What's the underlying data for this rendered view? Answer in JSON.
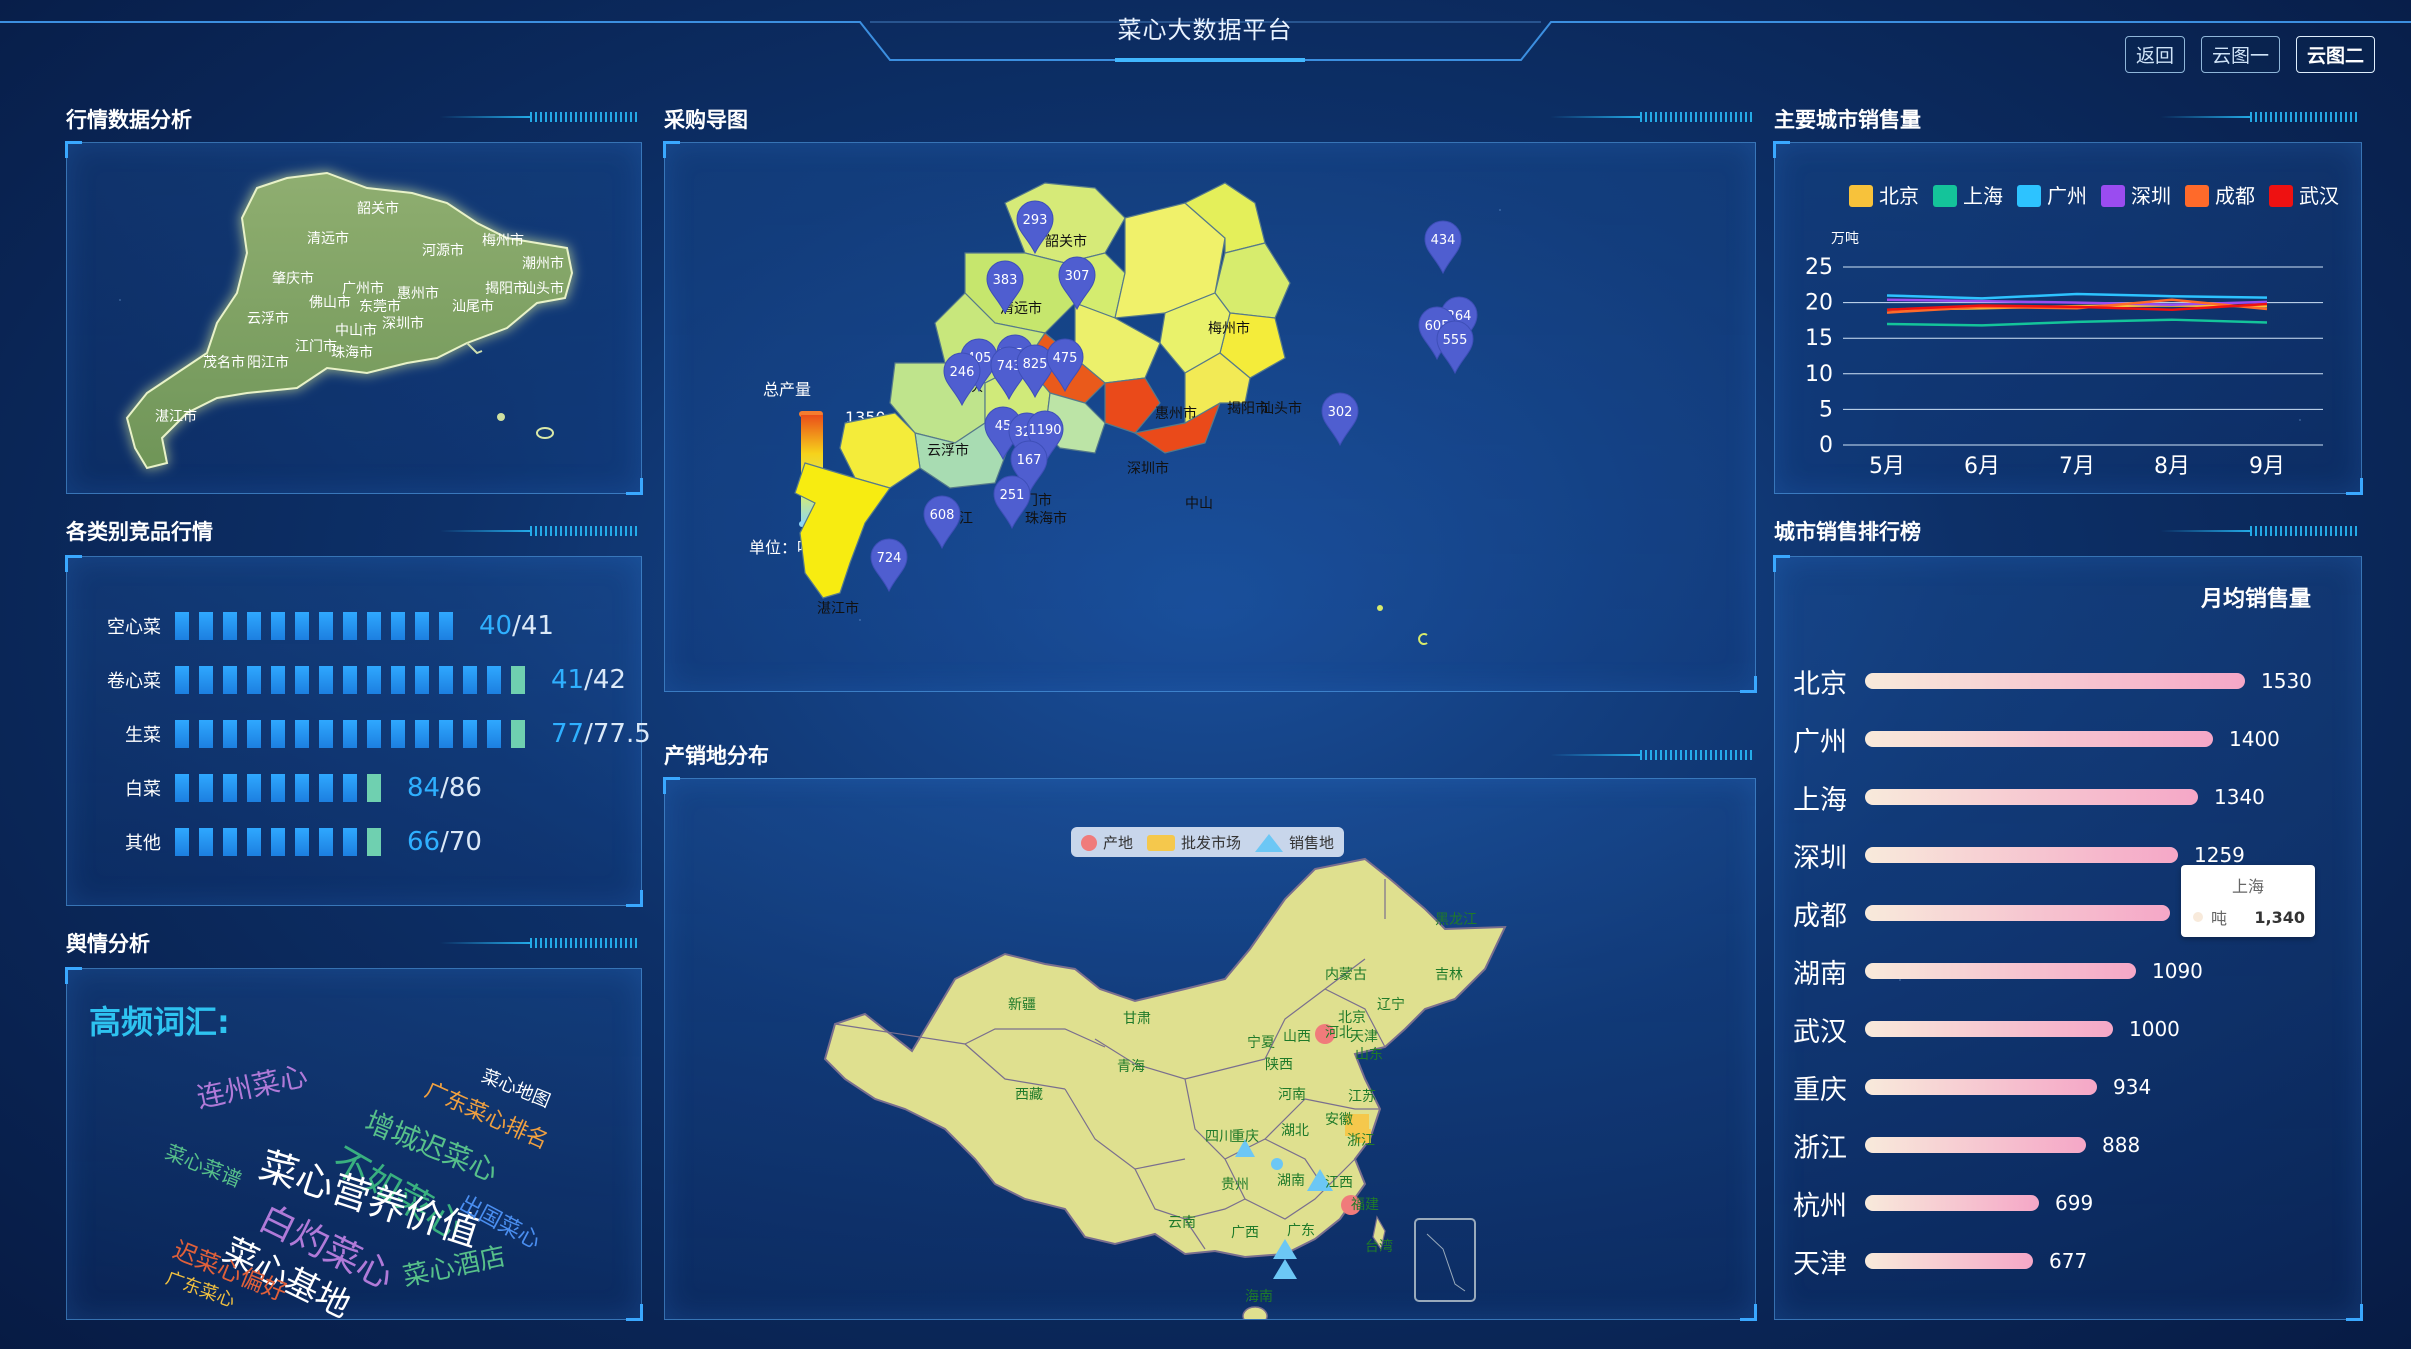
{
  "header": {
    "title": "菜心大数据平台",
    "buttons": [
      {
        "label": "返回",
        "active": false
      },
      {
        "label": "云图一",
        "active": false
      },
      {
        "label": "云图二",
        "active": true
      }
    ]
  },
  "market_analysis": {
    "title": "行情数据分析",
    "cities": [
      "韶关市",
      "清远市",
      "河源市",
      "梅州市",
      "潮州市",
      "肇庆市",
      "广州市",
      "惠州市",
      "揭阳市",
      "汕头市",
      "佛山市",
      "东莞市",
      "汕尾市",
      "云浮市",
      "中山市",
      "深圳市",
      "江门市",
      "珠海市",
      "茂名市",
      "阳江市",
      "湛江市"
    ]
  },
  "competitor": {
    "title": "各类别竞品行情",
    "rows": [
      {
        "label": "空心菜",
        "a": "40",
        "b": "/41"
      },
      {
        "label": "卷心菜",
        "a": "41",
        "b": "/42"
      },
      {
        "label": "生菜",
        "a": "77",
        "b": "/77.5"
      },
      {
        "label": "白菜",
        "a": "84",
        "b": "/86"
      },
      {
        "label": "其他",
        "a": "66",
        "b": "/70"
      }
    ]
  },
  "sentiment": {
    "title": "舆情分析",
    "cloud_title": "高频词汇:",
    "words": [
      "连州菜心",
      "增城迟菜心",
      "广东菜心排名",
      "菜心地图",
      "不如菜心",
      "菜心菜谱",
      "菜心营养价值",
      "出国菜心",
      "白灼菜心",
      "菜心基地",
      "迟菜心偏好",
      "菜心酒店",
      "广东菜心"
    ]
  },
  "purchase_map": {
    "title": "采购导图",
    "legend_title": "总产量",
    "legend_max": "1350",
    "legend_min": "0",
    "legend_unit": "单位：吨",
    "south_label": "s",
    "city_labels": [
      "韶关市",
      "清远市",
      "梅州市",
      "云浮市",
      "江门市",
      "湛江市",
      "揭阳市",
      "汕头市",
      "惠州市",
      "阳江",
      "珠海市",
      "深圳市",
      "肇庆",
      "中山"
    ],
    "pins": [
      {
        "value": "293"
      },
      {
        "value": "434"
      },
      {
        "value": "383"
      },
      {
        "value": "307"
      },
      {
        "value": "264"
      },
      {
        "value": "605"
      },
      {
        "value": "555"
      },
      {
        "value": "405"
      },
      {
        "value": "1350"
      },
      {
        "value": "743"
      },
      {
        "value": "825"
      },
      {
        "value": "475"
      },
      {
        "value": "246"
      },
      {
        "value": "302"
      },
      {
        "value": "45"
      },
      {
        "value": "320"
      },
      {
        "value": "1190"
      },
      {
        "value": "167"
      },
      {
        "value": "251"
      },
      {
        "value": "608"
      },
      {
        "value": "724"
      }
    ]
  },
  "distribution_map": {
    "title": "产销地分布",
    "legend": [
      {
        "label": "产地",
        "color": "#f07b7b"
      },
      {
        "label": "批发市场",
        "color": "#f5c84c"
      },
      {
        "label": "销售地",
        "color": "#6cc7f5"
      }
    ],
    "provinces": [
      "黑龙江",
      "吉林",
      "辽宁",
      "内蒙古",
      "北京",
      "天津",
      "河北",
      "山西",
      "山东",
      "宁夏",
      "陕西",
      "河南",
      "江苏",
      "甘肃",
      "青海",
      "新疆",
      "西藏",
      "四川",
      "重庆",
      "湖北",
      "安徽",
      "浙江",
      "江西",
      "湖南",
      "福建",
      "贵州",
      "云南",
      "广西",
      "广东",
      "台湾",
      "海南"
    ]
  },
  "city_sales": {
    "title": "主要城市销售量",
    "chart_data": {
      "type": "line",
      "x": [
        "5月",
        "6月",
        "7月",
        "8月",
        "9月"
      ],
      "ylabel": "万吨",
      "ylim": [
        0,
        25
      ],
      "yticks": [
        "0",
        "5",
        "10",
        "15",
        "20",
        "25"
      ],
      "series": [
        {
          "name": "北京",
          "color": "#f7c23b",
          "values": [
            19.0,
            19.2,
            19.5,
            19.6,
            19.5
          ]
        },
        {
          "name": "上海",
          "color": "#14c49a",
          "values": [
            17.0,
            16.8,
            17.3,
            17.6,
            17.2
          ]
        },
        {
          "name": "广州",
          "color": "#2dc3ff",
          "values": [
            21.0,
            20.6,
            21.2,
            20.9,
            20.7
          ]
        },
        {
          "name": "深圳",
          "color": "#9a4cf0",
          "values": [
            20.4,
            20.2,
            20.0,
            19.7,
            20.1
          ]
        },
        {
          "name": "成都",
          "color": "#ff6a2a",
          "values": [
            18.6,
            19.4,
            19.2,
            20.4,
            19.1
          ]
        },
        {
          "name": "武汉",
          "color": "#ee1111",
          "values": [
            19.0,
            19.6,
            19.4,
            19.0,
            19.8
          ]
        }
      ]
    }
  },
  "ranking": {
    "title": "城市销售排行榜",
    "subtitle": "月均销售量",
    "rows": [
      {
        "name": "北京",
        "value": 1530
      },
      {
        "name": "广州",
        "value": 1400
      },
      {
        "name": "上海",
        "value": 1340
      },
      {
        "name": "深圳",
        "value": 1259
      },
      {
        "name": "成都",
        "value": 1229
      },
      {
        "name": "湖南",
        "value": 1090
      },
      {
        "name": "武汉",
        "value": 1000
      },
      {
        "name": "重庆",
        "value": 934
      },
      {
        "name": "浙江",
        "value": 888
      },
      {
        "name": "杭州",
        "value": 699
      },
      {
        "name": "天津",
        "value": 677
      }
    ],
    "tooltip": {
      "title": "上海",
      "unit": "吨",
      "value": "1,340"
    }
  }
}
